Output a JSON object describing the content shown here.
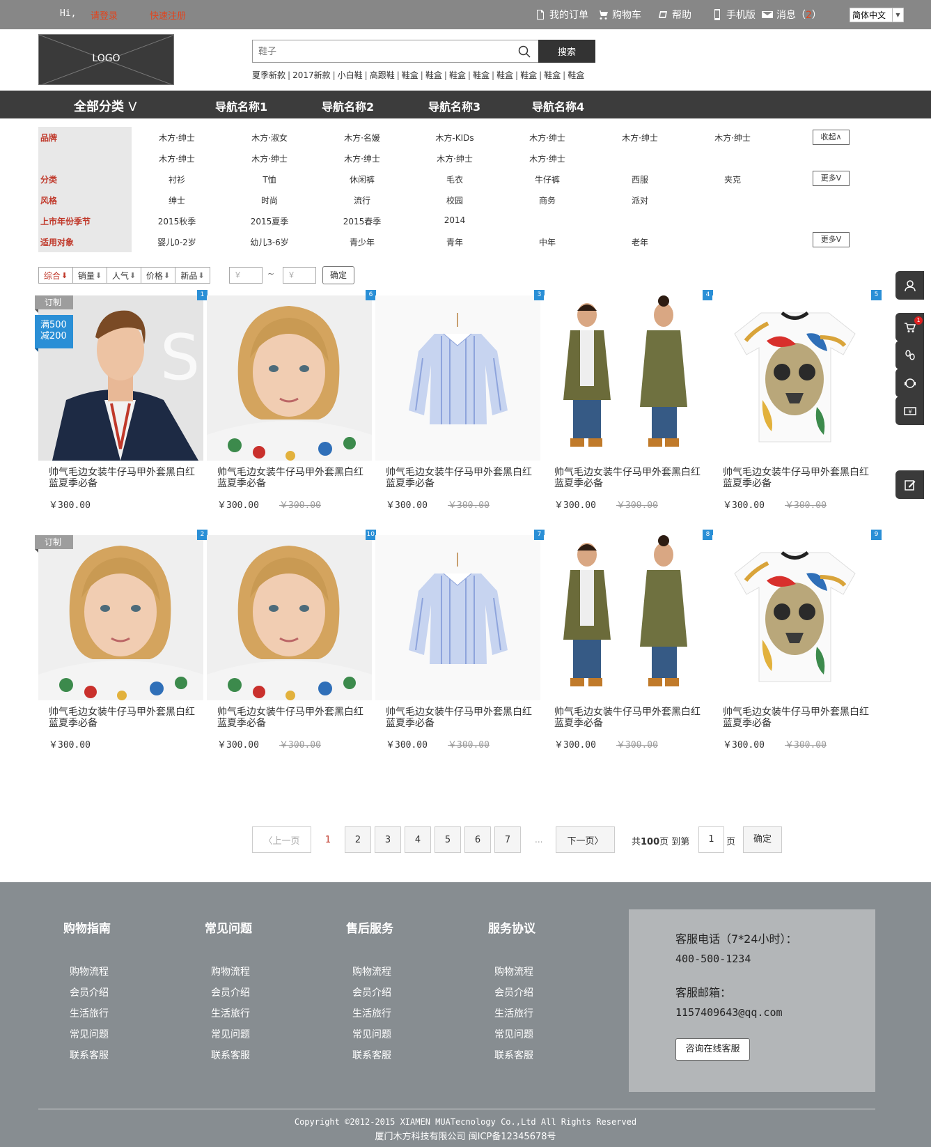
{
  "topbar": {
    "greeting": "Hi,",
    "login": "请登录",
    "register": "快速注册",
    "orders": "我的订单",
    "cart": "购物车",
    "help": "帮助",
    "mobile": "手机版",
    "messages": "消息（",
    "message_count": "2",
    "messages_close": "）",
    "language": "简体中文"
  },
  "header": {
    "logo": "LOGO",
    "search_placeholder": "鞋子",
    "search_button": "搜索",
    "hotwords": [
      "夏季新款",
      "2017新款",
      "小白鞋",
      "高跟鞋",
      "鞋盒",
      "鞋盒",
      "鞋盒",
      "鞋盒",
      "鞋盒",
      "鞋盒",
      "鞋盒",
      "鞋盒"
    ]
  },
  "nav": {
    "all": "全部分类",
    "all_arrow": "V",
    "items": [
      "导航名称1",
      "导航名称2",
      "导航名称3",
      "导航名称4"
    ]
  },
  "filters": {
    "brand": {
      "label": "品牌",
      "row1": [
        "木方·绅士",
        "木方·淑女",
        "木方·名媛",
        "木方-KIDs",
        "木方·绅士",
        "木方·绅士",
        "木方·绅士"
      ],
      "row2": [
        "木方·绅士",
        "木方·绅士",
        "木方·绅士",
        "木方·绅士",
        "木方·绅士"
      ],
      "button": "收起∧"
    },
    "category": {
      "label": "分类",
      "values": [
        "衬衫",
        "T恤",
        "休闲裤",
        "毛衣",
        "牛仔裤",
        "西服",
        "夹克"
      ],
      "button": "更多V"
    },
    "style": {
      "label": "风格",
      "values": [
        "绅士",
        "时尚",
        "流行",
        "校园",
        "商务",
        "派对"
      ]
    },
    "season": {
      "label": "上市年份季节",
      "values": [
        "2015秋季",
        "2015夏季",
        "2015春季",
        "2014"
      ]
    },
    "target": {
      "label": "适用对象",
      "values": [
        "婴儿0-2岁",
        "幼儿3-6岁",
        "青少年",
        "青年",
        "中年",
        "老年"
      ],
      "button": "更多V"
    }
  },
  "sort": {
    "options": [
      "综合",
      "销量",
      "人气",
      "价格",
      "新品"
    ],
    "arrow": "⬇",
    "price_min_placeholder": "￥",
    "price_max_placeholder": "￥",
    "tilde": "~",
    "confirm": "确定"
  },
  "products": [
    {
      "rank": "1",
      "title": "帅气毛边女装牛仔马甲外套黑白红蓝夏季必备",
      "price": "￥300.00",
      "orig": "",
      "tag": "订制",
      "promo1": "满500",
      "promo2": "减200",
      "img": "man"
    },
    {
      "rank": "6",
      "title": "帅气毛边女装牛仔马甲外套黑白红蓝夏季必备",
      "price": "￥300.00",
      "orig": "￥300.00",
      "tag": "",
      "promo1": "",
      "promo2": "",
      "img": "girl"
    },
    {
      "rank": "3",
      "title": "帅气毛边女装牛仔马甲外套黑白红蓝夏季必备",
      "price": "￥300.00",
      "orig": "￥300.00",
      "tag": "",
      "promo1": "",
      "promo2": "",
      "img": "shirt"
    },
    {
      "rank": "4",
      "title": "帅气毛边女装牛仔马甲外套黑白红蓝夏季必备",
      "price": "￥300.00",
      "orig": "￥300.00",
      "tag": "",
      "promo1": "",
      "promo2": "",
      "img": "coat"
    },
    {
      "rank": "5",
      "title": "帅气毛边女装牛仔马甲外套黑白红蓝夏季必备",
      "price": "￥300.00",
      "orig": "￥300.00",
      "tag": "",
      "promo1": "",
      "promo2": "",
      "img": "tee"
    },
    {
      "rank": "2",
      "title": "帅气毛边女装牛仔马甲外套黑白红蓝夏季必备",
      "price": "￥300.00",
      "orig": "",
      "tag": "订制",
      "promo1": "",
      "promo2": "",
      "img": "girl"
    },
    {
      "rank": "10",
      "title": "帅气毛边女装牛仔马甲外套黑白红蓝夏季必备",
      "price": "￥300.00",
      "orig": "￥300.00",
      "tag": "",
      "promo1": "",
      "promo2": "",
      "img": "girl"
    },
    {
      "rank": "7",
      "title": "帅气毛边女装牛仔马甲外套黑白红蓝夏季必备",
      "price": "￥300.00",
      "orig": "￥300.00",
      "tag": "",
      "promo1": "",
      "promo2": "",
      "img": "shirt"
    },
    {
      "rank": "8",
      "title": "帅气毛边女装牛仔马甲外套黑白红蓝夏季必备",
      "price": "￥300.00",
      "orig": "￥300.00",
      "tag": "",
      "promo1": "",
      "promo2": "",
      "img": "coat"
    },
    {
      "rank": "9",
      "title": "帅气毛边女装牛仔马甲外套黑白红蓝夏季必备",
      "price": "￥300.00",
      "orig": "￥300.00",
      "tag": "",
      "promo1": "",
      "promo2": "",
      "img": "tee"
    }
  ],
  "pagination": {
    "prev": "上一页",
    "pages": [
      "1",
      "2",
      "3",
      "4",
      "5",
      "6",
      "7"
    ],
    "current": "1",
    "dots": "...",
    "next": "下一页",
    "total_prefix": "共",
    "total": "100",
    "total_suffix": "页  到第",
    "jump_value": "1",
    "unit": "页",
    "confirm": "确定"
  },
  "sidebar_float": {
    "cart_count": "1"
  },
  "footer": {
    "columns": [
      {
        "title": "购物指南",
        "links": [
          "购物流程",
          "会员介绍",
          "生活旅行",
          "常见问题",
          "联系客服"
        ]
      },
      {
        "title": "常见问题",
        "links": [
          "购物流程",
          "会员介绍",
          "生活旅行",
          "常见问题",
          "联系客服"
        ]
      },
      {
        "title": "售后服务",
        "links": [
          "购物流程",
          "会员介绍",
          "生活旅行",
          "常见问题",
          "联系客服"
        ]
      },
      {
        "title": "服务协议",
        "links": [
          "购物流程",
          "会员介绍",
          "生活旅行",
          "常见问题",
          "联系客服"
        ]
      }
    ],
    "service_phone_label": "客服电话（7*24小时）：",
    "service_phone": "400-500-1234",
    "service_email_label": "客服邮箱：",
    "service_email": "1157409643@qq.com",
    "service_button": "咨询在线客服",
    "copyright": "Copyright ©2012-2015 XIAMEN MUATecnology Co.,Ltd All Rights Reserved",
    "company": "厦门木方科技有限公司 闽ICP备12345678号"
  },
  "colors": {
    "accent_red": "#c0392b",
    "rank_blue": "#2a8fd6",
    "nav_dark": "#3c3c3c",
    "footer_gray": "#878d91"
  }
}
